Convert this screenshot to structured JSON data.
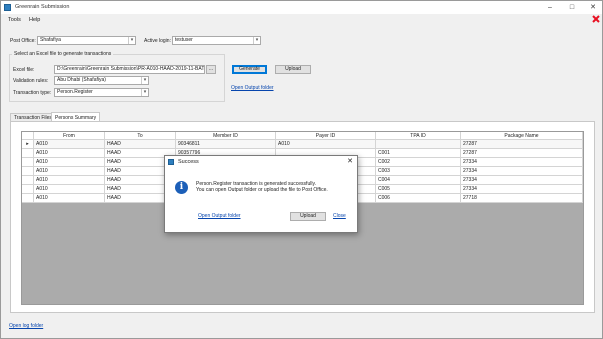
{
  "window": {
    "title": "Greenrain Submission",
    "controls": {
      "minimize": "–",
      "maximize": "□",
      "close": "✕"
    }
  },
  "menu": {
    "items": [
      "Tools",
      "Help"
    ]
  },
  "form": {
    "post_office_label": "Post Office:",
    "post_office_value": "Shafafiya",
    "active_login_label": "Active login:",
    "active_login_value": "testuser",
    "group_title": "Select an Excel file to generate transactions",
    "excel_file_label": "Excel file:",
    "excel_file_value": "D:\\Greenrain\\Greenrain Submission\\PR-A010-HAAD-2019-11-BATCH",
    "browse_label": "...",
    "validation_rules_label": "Validation rules:",
    "validation_rules_value": "Abu Dhabi (Shafafiya)",
    "transaction_type_label": "Transaction type:",
    "transaction_type_value": "Person.Register",
    "generate_label": "Generate",
    "upload_label": "Upload",
    "open_output_folder": "Open Output folder"
  },
  "tabs": [
    {
      "label": "Transaction Files",
      "active": false
    },
    {
      "label": "Persons Summary",
      "active": true
    }
  ],
  "grid": {
    "columns": [
      "From",
      "To",
      "Member ID",
      "Payer ID",
      "TPA ID",
      "Package Name"
    ],
    "rows": [
      {
        "marker": "▸",
        "cells": [
          "A010",
          "HAAD",
          "90346811",
          "A010",
          "",
          "27287"
        ]
      },
      {
        "marker": "",
        "cells": [
          "A010",
          "HAAD",
          "90357796",
          "",
          "C001",
          "27287"
        ]
      },
      {
        "marker": "",
        "cells": [
          "A010",
          "HAAD",
          "90289",
          "",
          "C002",
          "27334"
        ]
      },
      {
        "marker": "",
        "cells": [
          "A010",
          "HAAD",
          "90289",
          "",
          "C003",
          "27334"
        ]
      },
      {
        "marker": "",
        "cells": [
          "A010",
          "HAAD",
          "90289",
          "",
          "C004",
          "27334"
        ]
      },
      {
        "marker": "",
        "cells": [
          "A010",
          "HAAD",
          "90289",
          "",
          "C005",
          "27334"
        ]
      },
      {
        "marker": "",
        "cells": [
          "A010",
          "HAAD",
          "90151",
          "",
          "C006",
          "27718"
        ]
      }
    ]
  },
  "footer": {
    "open_log_folder": "Open log folder"
  },
  "dialog": {
    "title": "Success",
    "close": "✕",
    "icon_glyph": "i",
    "message_line1": "Person.Register transaction is generated successfully.",
    "message_line2": "You can open Output folder or upload the file to Post Office.",
    "open_output_folder": "Open Output folder",
    "upload_label": "Upload",
    "close_label": "Close"
  },
  "colors": {
    "accent": "#0078d7",
    "link": "#0645ad",
    "close_red": "#e81123",
    "info_blue": "#1c5fb8"
  },
  "icons": {
    "app": "app-icon",
    "red_close": "red-x-icon",
    "info": "info-icon"
  }
}
